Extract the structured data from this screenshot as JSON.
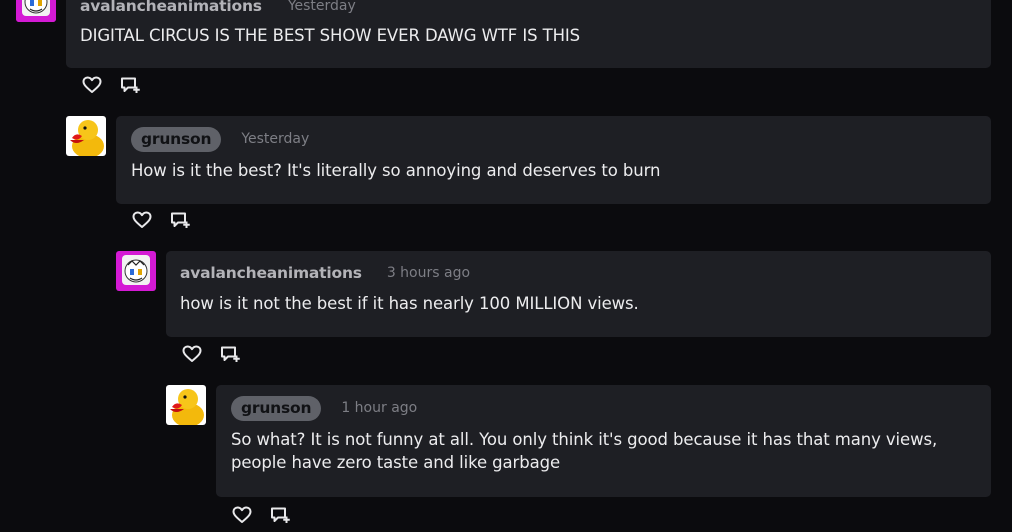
{
  "comments": [
    {
      "username": "avalancheanimations",
      "timestamp": "Yesterday",
      "text": "DIGITAL CIRCUS IS THE BEST SHOW EVER DAWG WTF IS THIS",
      "avatar": "avalanche-avatar"
    },
    {
      "username": "grunson",
      "timestamp": "Yesterday",
      "text": "How is it the best? It's literally so annoying and deserves to burn",
      "avatar": "duck-avatar"
    },
    {
      "username": "avalancheanimations",
      "timestamp": "3 hours ago",
      "text": "how is it not the best if it has nearly 100 MILLION views.",
      "avatar": "avalanche-avatar"
    },
    {
      "username": "grunson",
      "timestamp": "1 hour ago",
      "text_lines": [
        "So what? It is not funny at all. You only think it's good because it has that many views,",
        "people have zero taste and like garbage"
      ],
      "avatar": "duck-avatar"
    }
  ],
  "icons": {
    "like": "heart-icon",
    "reply": "reply-icon"
  },
  "colors": {
    "background": "#0b0b0e",
    "bubble": "#1e1f24",
    "pill": "#5f6168",
    "avatar_magenta": "#d41ad4"
  }
}
